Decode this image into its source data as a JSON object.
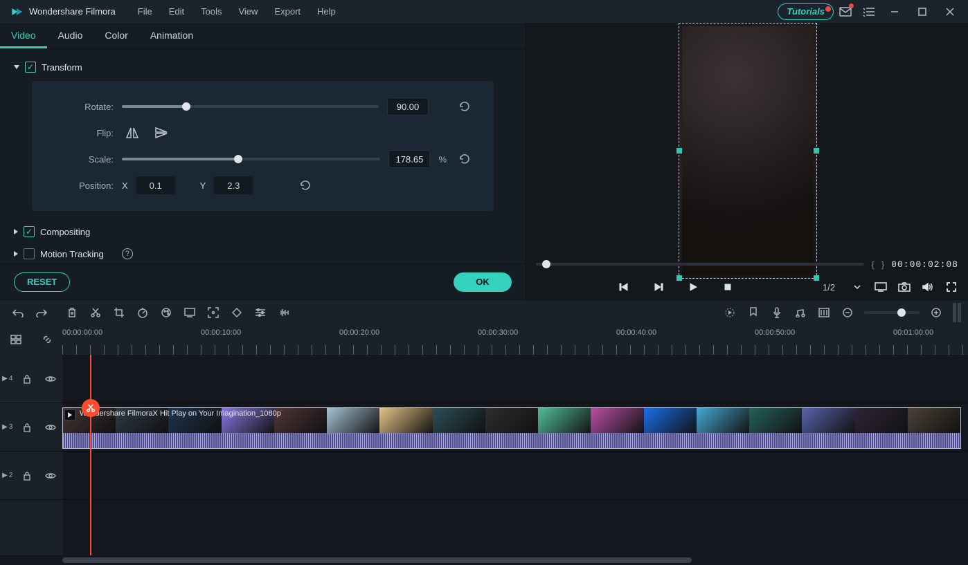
{
  "titlebar": {
    "app_name": "Wondershare Filmora",
    "menus": [
      "File",
      "Edit",
      "Tools",
      "View",
      "Export",
      "Help"
    ],
    "tutorials": "Tutorials"
  },
  "property_tabs": [
    "Video",
    "Audio",
    "Color",
    "Animation"
  ],
  "active_property_tab": 0,
  "transform": {
    "title": "Transform",
    "rotate_label": "Rotate:",
    "rotate_value": "90.00",
    "rotate_pct": 25,
    "flip_label": "Flip:",
    "scale_label": "Scale:",
    "scale_value": "178.65",
    "scale_pct": 45,
    "percent": "%",
    "position_label": "Position:",
    "pos_x_label": "X",
    "pos_x": "0.1",
    "pos_y_label": "Y",
    "pos_y": "2.3"
  },
  "compositing": {
    "title": "Compositing"
  },
  "motion_tracking": {
    "title": "Motion Tracking"
  },
  "footer": {
    "reset": "RESET",
    "ok": "OK"
  },
  "preview": {
    "timecode": "00:00:02:08",
    "zoom_ratio": "1/2"
  },
  "ruler": [
    "00:00:00:00",
    "00:00:10:00",
    "00:00:20:00",
    "00:00:30:00",
    "00:00:40:00",
    "00:00:50:00",
    "00:01:00:00"
  ],
  "tracks": [
    {
      "id": "4"
    },
    {
      "id": "3"
    },
    {
      "id": "2"
    }
  ],
  "clip": {
    "title": "Wondershare FilmoraX   Hit Play on Your Imagination_1080p"
  },
  "thumb_colors": [
    "#463334",
    "#2c3a46",
    "#1e344f",
    "#8a78e3",
    "#513538",
    "#a4c2d2",
    "#e3c487",
    "#2c4e58",
    "#2e2e2e",
    "#51bd96",
    "#b94fa6",
    "#1a6fe8",
    "#45a8d1",
    "#246159",
    "#5963a8",
    "#2e2536",
    "#4a4137"
  ]
}
